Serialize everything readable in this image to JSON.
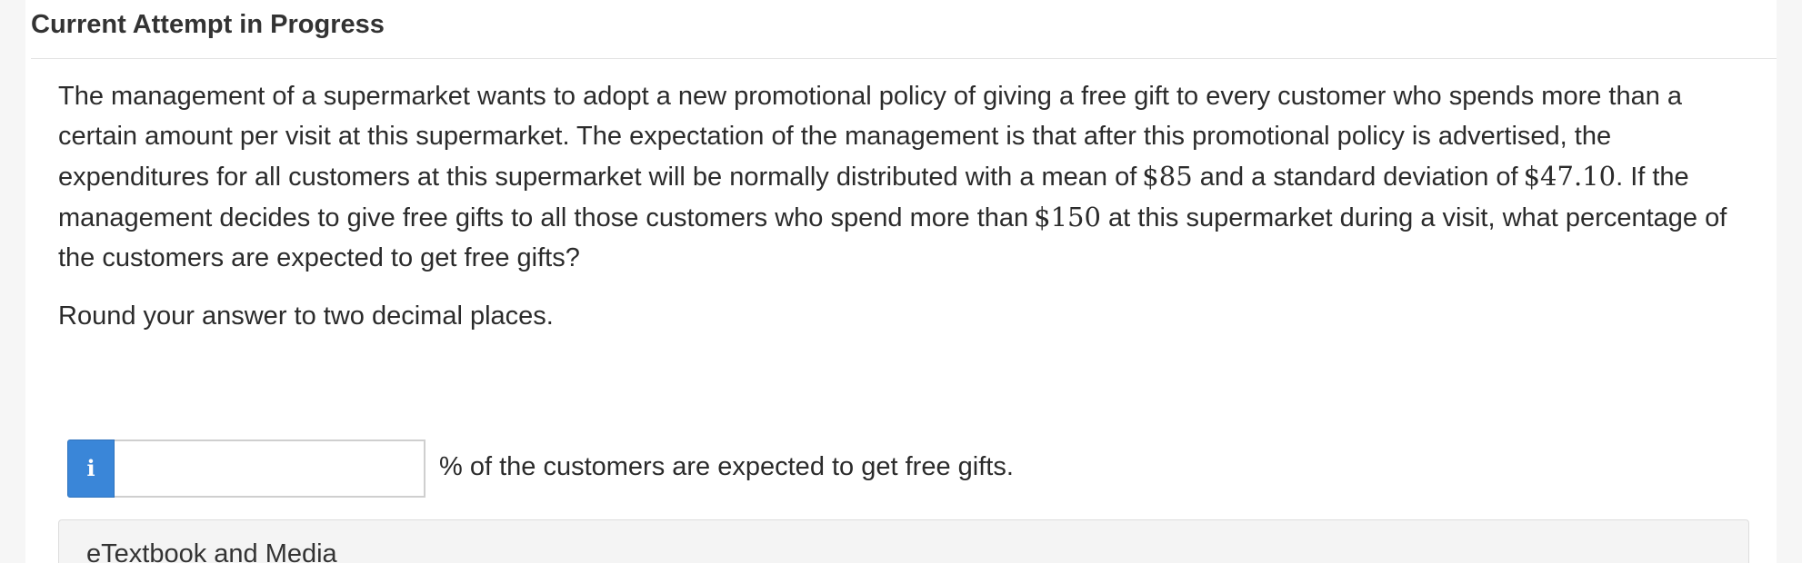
{
  "header": {
    "title": "Current Attempt in Progress"
  },
  "question": {
    "text_part1": "The management of a supermarket wants to adopt a new promotional policy of giving a free gift to every customer who spends more than a certain amount per visit at this supermarket. The expectation of the management is that after this promotional policy is advertised, the expenditures for all customers at this supermarket will be normally distributed with a mean of",
    "mean": "$85",
    "text_part2": "and a standard deviation of",
    "std_dev": "$47.10",
    "text_part3": ". If the management decides to give free gifts to all those customers who spend more than",
    "threshold": "$150",
    "text_part4": "at this supermarket during a visit, what percentage of the customers are expected to get free gifts?",
    "round_note": "Round your answer to two decimal places."
  },
  "answer": {
    "info_icon": "i",
    "input_value": "",
    "suffix": "% of the customers are expected to get free gifts."
  },
  "etextbook": {
    "label": "eTextbook and Media"
  }
}
